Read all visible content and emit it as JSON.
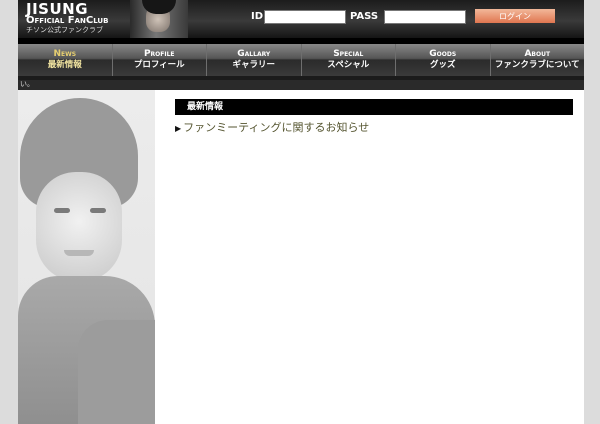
{
  "header": {
    "logo_main": "JISUNG",
    "logo_sub": "Official FanClub",
    "logo_jp": "チソン公式ファンクラブ",
    "id_label": "ID",
    "pass_label": "PASS",
    "id_value": "",
    "pass_value": "",
    "login_label": "ログイン"
  },
  "nav": [
    {
      "en": "News",
      "jp": "最新情報",
      "active": true
    },
    {
      "en": "Profile",
      "jp": "プロフィール"
    },
    {
      "en": "Gallary",
      "jp": "ギャラリー"
    },
    {
      "en": "Special",
      "jp": "スペシャル"
    },
    {
      "en": "Goods",
      "jp": "グッズ"
    },
    {
      "en": "About",
      "jp": "ファンクラブについて"
    }
  ],
  "ticker": "い。",
  "content": {
    "section_title": "最新情報",
    "news_items": [
      "ファンミーティングに関するお知らせ"
    ]
  },
  "colors": {
    "nav_active": "#e8d070",
    "login_button": "#e07650"
  },
  "icons": {
    "news_bullet": "triangle-right-icon"
  }
}
